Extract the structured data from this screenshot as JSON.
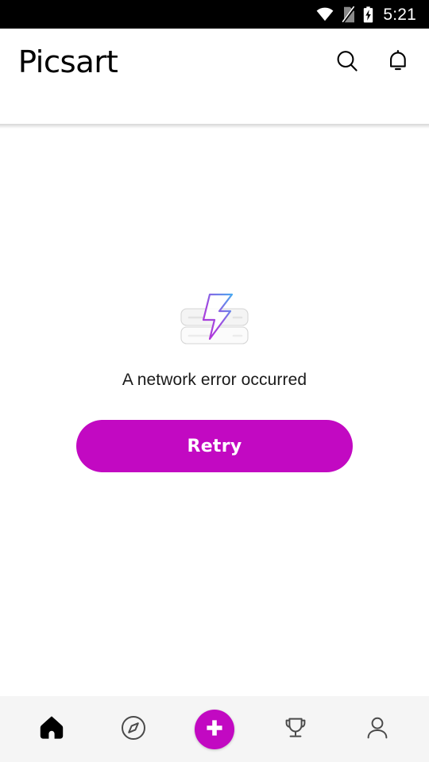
{
  "status_bar": {
    "time": "5:21",
    "icons": [
      {
        "name": "wifi-icon",
        "label": "Wi-Fi connected"
      },
      {
        "name": "sim-card-off-icon",
        "label": "No SIM card"
      },
      {
        "name": "battery-charging-icon",
        "label": "Battery charging"
      }
    ],
    "background": "#000000",
    "foreground": "#ffffff"
  },
  "header": {
    "logo_text": "Picsart",
    "actions": [
      {
        "name": "search-icon",
        "label": "Search"
      },
      {
        "name": "notifications-bell-icon",
        "label": "Notifications"
      }
    ]
  },
  "main": {
    "illustration_name": "network-error-server-bolt-illustration",
    "error_message": "A network error occurred",
    "retry_label": "Retry",
    "accent_color": "#c209c2",
    "bolt_gradient": [
      "#c32fd0",
      "#4aa8ef"
    ],
    "server_color": "#f2f2f2"
  },
  "bottom_nav": {
    "items": [
      {
        "name": "nav-home",
        "icon": "home-icon",
        "label": "Home",
        "active": true
      },
      {
        "name": "nav-explore",
        "icon": "compass-icon",
        "label": "Explore",
        "active": false
      },
      {
        "name": "nav-create",
        "icon": "plus-icon",
        "label": "Create",
        "active": false
      },
      {
        "name": "nav-challenges",
        "icon": "trophy-icon",
        "label": "Challenges",
        "active": false
      },
      {
        "name": "nav-profile",
        "icon": "person-icon",
        "label": "Profile",
        "active": false
      }
    ],
    "background": "#f5f5f5",
    "active_color": "#000000",
    "inactive_color": "#4a4a4a"
  }
}
